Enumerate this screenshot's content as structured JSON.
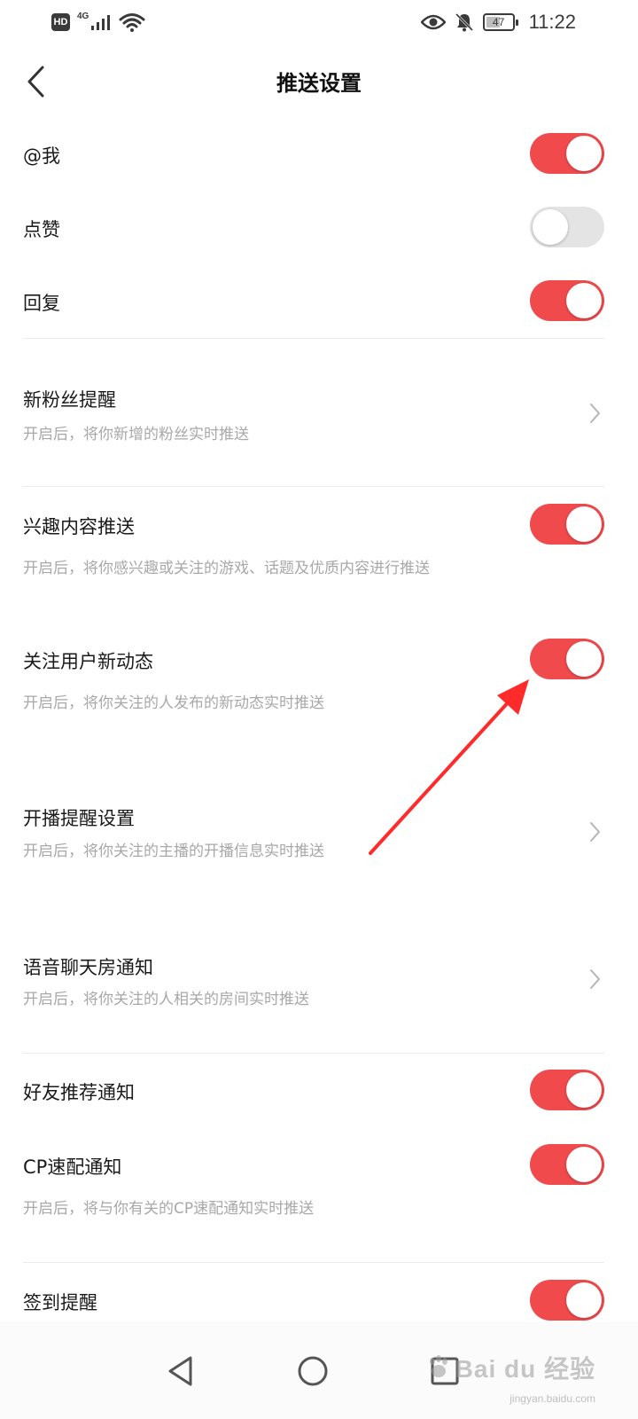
{
  "status_bar": {
    "hd_label": "HD",
    "network_label": "4G",
    "battery_level": "47",
    "time": "11:22"
  },
  "header": {
    "title": "推送设置"
  },
  "settings": [
    {
      "title": "@我",
      "toggle": true
    },
    {
      "title": "点赞",
      "toggle": false
    },
    {
      "title": "回复",
      "toggle": true
    },
    {
      "title": "新粉丝提醒",
      "description": "开启后，将你新增的粉丝实时推送",
      "control": "chevron"
    },
    {
      "title": "兴趣内容推送",
      "description": "开启后，将你感兴趣或关注的游戏、话题及优质内容进行推送",
      "toggle": true
    },
    {
      "title": "关注用户新动态",
      "description": "开启后，将你关注的人发布的新动态实时推送",
      "toggle": true
    },
    {
      "title": "开播提醒设置",
      "description": "开启后，将你关注的主播的开播信息实时推送",
      "control": "chevron"
    },
    {
      "title": "语音聊天房通知",
      "description": "开启后，将你关注的人相关的房间实时推送",
      "control": "chevron"
    },
    {
      "title": "好友推荐通知",
      "toggle": true
    },
    {
      "title": "CP速配通知",
      "description": "开启后，将与你有关的CP速配通知实时推送",
      "toggle": true
    },
    {
      "title": "签到提醒",
      "toggle": true
    }
  ],
  "colors": {
    "toggle_on": "#f04a4c",
    "toggle_off": "#e4e4e4",
    "annotation_arrow": "#ff2a2a"
  },
  "icons": {
    "back": "chevron-left-icon",
    "row_arrow": "chevron-right-icon",
    "nav_back": "triangle-back-icon",
    "nav_home": "circle-home-icon",
    "nav_recent": "square-recent-icon"
  },
  "watermark": {
    "brand": "Bai du 经验",
    "url": "jingyan.baidu.com"
  }
}
